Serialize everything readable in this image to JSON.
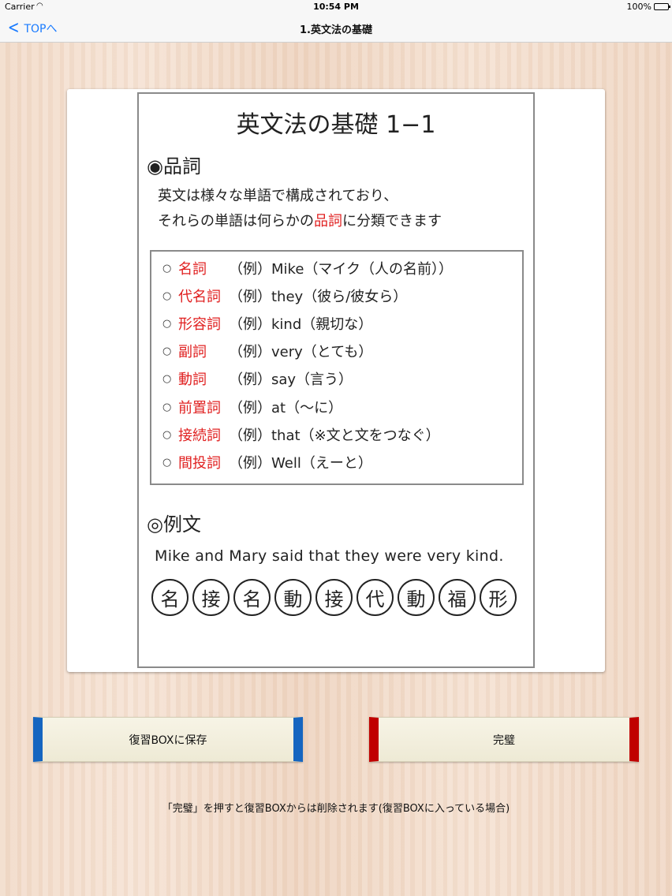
{
  "status_bar": {
    "carrier": "Carrier",
    "time": "10:54 PM",
    "battery": "100%",
    "battery_level": 1.0
  },
  "nav": {
    "back_label": "TOPへ",
    "title": "1.英文法の基礎"
  },
  "lesson": {
    "heading": "英文法の基礎 1−1",
    "section1_title": "◉品詞",
    "intro_line1": "英文は様々な単語で構成されており、",
    "intro_line2_pre": "それらの単語は何らかの",
    "intro_line2_highlight": "品詞",
    "intro_line2_post": "に分類できます",
    "parts_of_speech": [
      {
        "term": "名詞",
        "example": "（例）Mike（マイク（人の名前））"
      },
      {
        "term": "代名詞",
        "example": "（例）they（彼ら/彼女ら）"
      },
      {
        "term": "形容詞",
        "example": "（例）kind（親切な）"
      },
      {
        "term": "副詞",
        "example": "（例）very（とても）"
      },
      {
        "term": "動詞",
        "example": "（例）say（言う）"
      },
      {
        "term": "前置詞",
        "example": "（例）at（〜に）"
      },
      {
        "term": "接続詞",
        "example": "（例）that（※文と文をつなぐ）"
      },
      {
        "term": "間投詞",
        "example": "（例）Well（えーと）"
      }
    ],
    "bullet": "○",
    "section2_title": "◎例文",
    "example_sentence": "Mike and Mary said that they were very kind.",
    "labels": [
      "名",
      "接",
      "名",
      "動",
      "接",
      "代",
      "動",
      "福",
      "形"
    ]
  },
  "buttons": {
    "save_label": "復習BOXに保存",
    "done_label": "完璧"
  },
  "note": "「完璧」を押すと復習BOXからは削除されます(復習BOXに入っている場合)",
  "colors": {
    "accent_blue": "#1565c0",
    "accent_red": "#c00000",
    "highlight_red": "#e02020",
    "link_blue": "#1a7bff"
  }
}
